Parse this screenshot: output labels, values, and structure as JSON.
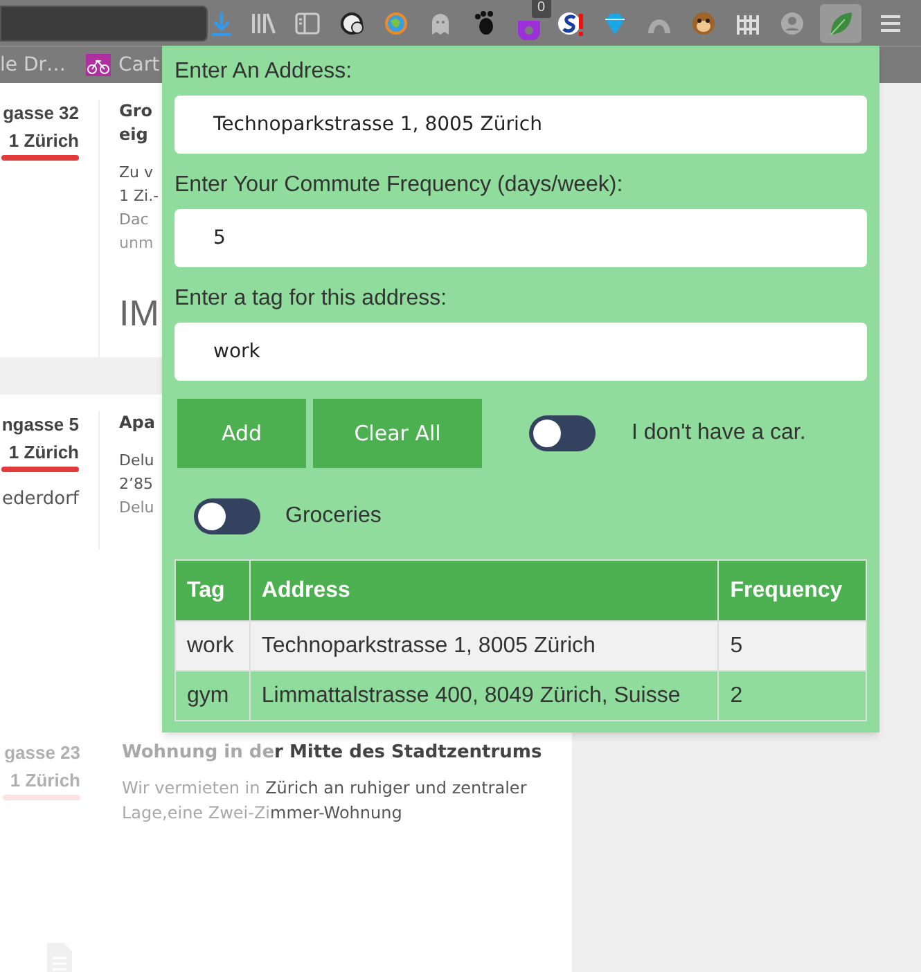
{
  "toolbar": {
    "extension_badge": "0"
  },
  "bookmarks": [
    "le Dr…",
    "Cart"
  ],
  "listings": [
    {
      "street": "gasse 32",
      "city": "1 Zürich",
      "title_lines": [
        "Gro",
        "eig"
      ],
      "lines": [
        "Zu v",
        "1 Zi.-",
        "Dac",
        "unm"
      ],
      "logo_text": "IM"
    },
    {
      "street": "ngasse 5",
      "city": "1 Zürich",
      "district": "ederdorf",
      "title_lines": [
        "Apa"
      ],
      "lines": [
        "Delu",
        "2’85",
        "Delu"
      ]
    },
    {
      "street": "gasse 23",
      "city": "1 Zürich",
      "title_faded": "Wohnung in de",
      "title": "r Mitte des Stadtzentrums",
      "lines": [
        {
          "faded": "Wir vermieten in ",
          "text": "Zürich an ruhiger und zentraler"
        },
        {
          "faded": "Lage,eine Zwei-Zi",
          "text": "mmer-Wohnung"
        }
      ]
    }
  ],
  "popup": {
    "fields": [
      {
        "label": "Enter An Address:",
        "value": "Technoparkstrasse 1, 8005 Zürich"
      },
      {
        "label": "Enter Your Commute Frequency (days/week):",
        "value": "5"
      },
      {
        "label": "Enter a tag for this address:",
        "value": "work"
      }
    ],
    "buttons": [
      "Add",
      "Clear All"
    ],
    "toggles": [
      {
        "label": "I don't have a car.",
        "on": false
      },
      {
        "label": "Groceries",
        "on": false
      }
    ],
    "table": {
      "columns": [
        "Tag",
        "Address",
        "Frequency"
      ],
      "rows": [
        [
          "work",
          "Technoparkstrasse 1, 8005 Zürich",
          "5"
        ],
        [
          "gym",
          "Limmattalstrasse 400, 8049 Zürich, Suisse",
          "2"
        ]
      ]
    }
  }
}
